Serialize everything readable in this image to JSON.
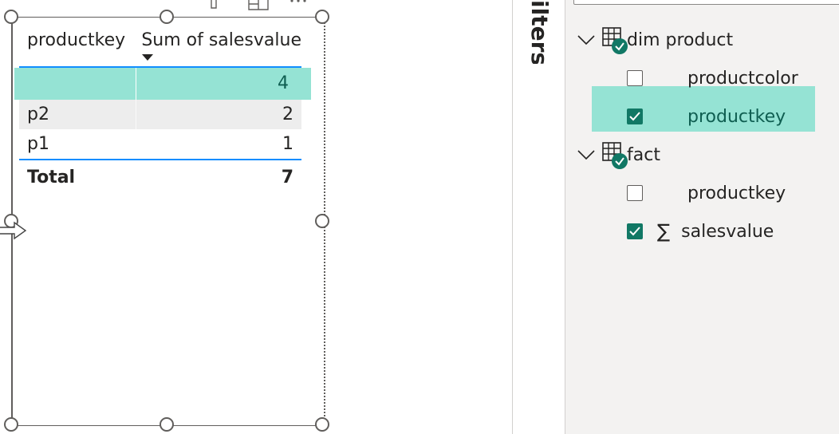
{
  "table_visual": {
    "headers": [
      "productkey",
      "Sum of salesvalue"
    ],
    "sorted_column": "Sum of salesvalue",
    "rows": [
      {
        "productkey": "",
        "value": "4",
        "selected": true
      },
      {
        "productkey": "p2",
        "value": "2"
      },
      {
        "productkey": "p1",
        "value": "1"
      }
    ],
    "total": {
      "label": "Total",
      "value": "7"
    }
  },
  "filters_pane": {
    "label": "ilters"
  },
  "fields_pane": {
    "tables": [
      {
        "name": "dim product",
        "icon": "table-icon",
        "fields": [
          {
            "name": "productcolor",
            "checked": false
          },
          {
            "name": "productkey",
            "checked": true,
            "highlighted": true
          }
        ]
      },
      {
        "name": "fact",
        "icon": "table-icon",
        "fields": [
          {
            "name": "productkey",
            "checked": false
          },
          {
            "name": "salesvalue",
            "checked": true,
            "sigma": "∑"
          }
        ]
      }
    ]
  },
  "colors": {
    "selection": "#95e3d4",
    "accent_blue": "#118dff",
    "check_green": "#117865"
  }
}
